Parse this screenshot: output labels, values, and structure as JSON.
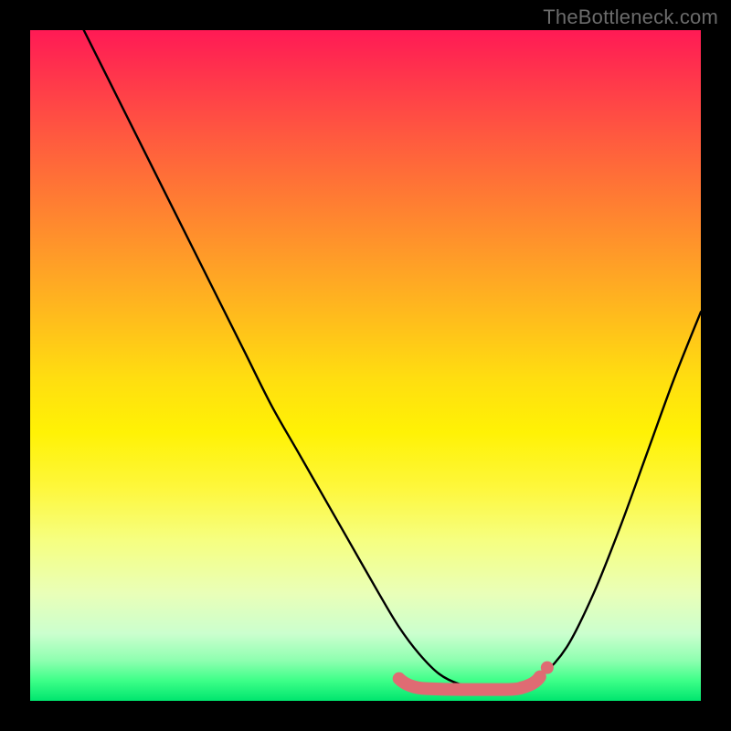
{
  "watermark": "TheBottleneck.com",
  "chart_data": {
    "type": "line",
    "title": "",
    "xlabel": "",
    "ylabel": "",
    "xlim": [
      0,
      100
    ],
    "ylim": [
      0,
      100
    ],
    "grid": false,
    "legend": false,
    "series": [
      {
        "name": "curve",
        "color": "#000000",
        "x": [
          8,
          12,
          16,
          20,
          24,
          28,
          32,
          36,
          40,
          44,
          48,
          52,
          55,
          58,
          61,
          64,
          67,
          70,
          73,
          76,
          80,
          84,
          88,
          92,
          96,
          100
        ],
        "y": [
          100,
          92,
          84,
          76,
          68,
          60,
          52,
          44,
          37,
          30,
          23,
          16,
          11,
          7,
          4,
          2.5,
          2,
          2,
          2.2,
          3.5,
          8,
          16,
          26,
          37,
          48,
          58
        ]
      }
    ],
    "highlight": {
      "name": "optimal-range",
      "color": "#e06c75",
      "x_range": [
        55,
        76
      ],
      "y_level": 2.5
    },
    "background_gradient": {
      "top": "#ff1a55",
      "middle": "#ffe210",
      "bottom": "#00e56e"
    }
  }
}
